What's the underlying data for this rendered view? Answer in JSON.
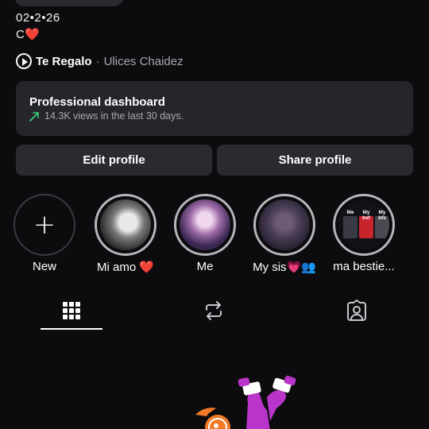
{
  "bio": {
    "date_line": "02•2•26",
    "letter": "C",
    "heart": "❤️"
  },
  "music": {
    "icon": "play-circle-icon",
    "title": "Te Regalo",
    "separator": "·",
    "artist": "Ulices Chaidez"
  },
  "dashboard": {
    "title": "Professional dashboard",
    "icon": "trending-up-icon",
    "subtitle": "14.3K views in the last 30 days."
  },
  "buttons": {
    "edit_label": "Edit profile",
    "share_label": "Share profile"
  },
  "highlights": [
    {
      "label": "New",
      "icon": "plus-icon"
    },
    {
      "label": "Mi amo ❤️"
    },
    {
      "label": "Me"
    },
    {
      "label": "My sis💗👥"
    },
    {
      "label": "ma bestie...",
      "thumb_texts": [
        "Me",
        "My bsf",
        "My bfs"
      ]
    }
  ],
  "tabs": [
    {
      "name": "posts-grid",
      "icon": "grid-icon",
      "active": true
    },
    {
      "name": "reposts",
      "icon": "repost-icon",
      "active": false
    },
    {
      "name": "tagged",
      "icon": "tagged-person-icon",
      "active": false
    }
  ],
  "colors": {
    "background": "#0c0c0e",
    "card": "#25262b",
    "button": "#2a2b30",
    "trend_green": "#3bd17d",
    "heart_red": "#e0243a",
    "sticker_purple": "#b934c8",
    "sticker_orange": "#f07a26"
  }
}
